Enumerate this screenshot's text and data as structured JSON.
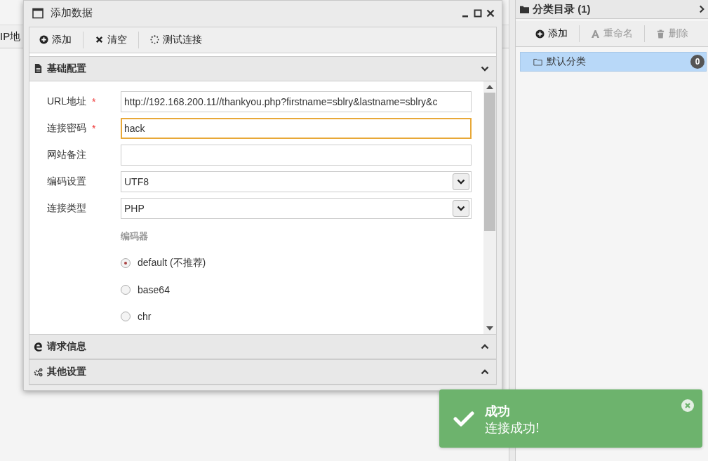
{
  "background_table": {
    "columns": [
      "IP地"
    ]
  },
  "category_panel": {
    "title": "分类目录 (1)",
    "toolbar": [
      {
        "label": "添加",
        "disabled": false
      },
      {
        "label": "重命名",
        "disabled": true
      },
      {
        "label": "删除",
        "disabled": true
      }
    ],
    "items": [
      {
        "label": "默认分类",
        "count": "0",
        "selected": true
      }
    ]
  },
  "dialog": {
    "title": "添加数据",
    "toolbar": [
      {
        "label": "添加"
      },
      {
        "label": "清空"
      },
      {
        "label": "测试连接"
      }
    ],
    "sections": [
      {
        "title": "基础配置",
        "expanded": true
      },
      {
        "title": "请求信息",
        "expanded": false
      },
      {
        "title": "其他设置",
        "expanded": false
      }
    ],
    "fields": [
      {
        "label": "URL地址",
        "required_mark": "*",
        "kind": "text",
        "value": "http://192.168.200.11//thankyou.php?firstname=sblry&lastname=sblry&c",
        "focused": false
      },
      {
        "label": "连接密码",
        "required_mark": "*",
        "kind": "text",
        "value": "hack",
        "focused": true
      },
      {
        "label": "网站备注",
        "kind": "text",
        "focused": false
      },
      {
        "label": "编码设置",
        "kind": "select",
        "value": "UTF8"
      },
      {
        "label": "连接类型",
        "kind": "select",
        "value": "PHP"
      }
    ],
    "encoder": {
      "label": "编码器",
      "options": [
        {
          "label": "default (不推荐)",
          "selected": true
        },
        {
          "label": "base64",
          "selected": false
        },
        {
          "label": "chr",
          "selected": false
        }
      ]
    }
  },
  "toast": {
    "title": "成功",
    "message": "连接成功!"
  }
}
